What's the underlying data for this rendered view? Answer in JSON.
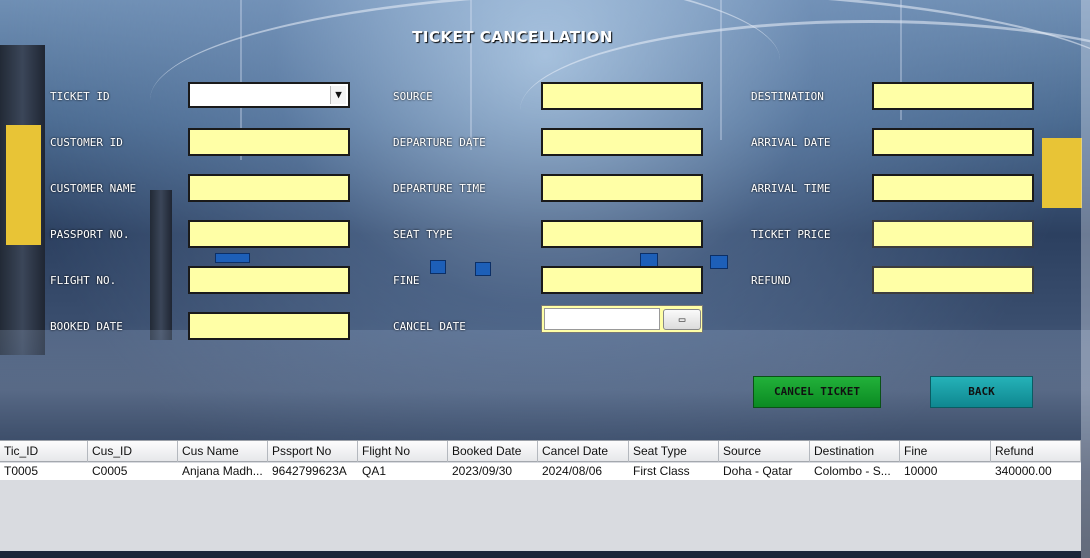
{
  "page_title": "TICKET CANCELLATION",
  "labels": {
    "ticket_id": "TICKET ID",
    "customer_id": "CUSTOMER ID",
    "customer_name": "CUSTOMER NAME",
    "passport_no": "PASSPORT NO.",
    "flight_no": "FLIGHT NO.",
    "booked_date": "BOOKED DATE",
    "source": "SOURCE",
    "departure_date": "DEPARTURE DATE",
    "departure_time": "DEPARTURE TIME",
    "seat_type": "SEAT TYPE",
    "fine": "FINE",
    "cancel_date": "CANCEL DATE",
    "destination": "DESTINATION",
    "arrival_date": "ARRIVAL DATE",
    "arrival_time": "ARRIVAL TIME",
    "ticket_price": "TICKET PRICE",
    "refund": "REFUND"
  },
  "fields": {
    "ticket_id": "",
    "customer_id": "",
    "customer_name": "",
    "passport_no": "",
    "flight_no": "",
    "booked_date": "",
    "source": "",
    "departure_date": "",
    "departure_time": "",
    "seat_type": "",
    "fine": "",
    "cancel_date": "",
    "destination": "",
    "arrival_date": "",
    "arrival_time": "",
    "ticket_price": "",
    "refund": ""
  },
  "buttons": {
    "cancel_ticket": "CANCEL TICKET",
    "back": "BACK"
  },
  "table": {
    "columns": [
      "Tic_ID",
      "Cus_ID",
      "Cus Name",
      "Pssport No",
      "Flight No",
      "Booked Date",
      "Cancel Date",
      "Seat Type",
      "Source",
      "Destination",
      "Fine",
      "Refund"
    ],
    "rows": [
      [
        "T0005",
        "C0005",
        "Anjana Madh...",
        "9642799623A",
        "QA1",
        "2023/09/30",
        "2024/08/06",
        "First Class",
        "Doha - Qatar",
        "Colombo - S...",
        "10000",
        "340000.00"
      ]
    ]
  },
  "icons": {
    "combo_arrow": "chevron-down-icon",
    "date_picker": "calendar-icon"
  },
  "colors": {
    "field_bg": "#ffffa6",
    "cancel_button": "#0b8a22",
    "back_button": "#0f8790"
  }
}
